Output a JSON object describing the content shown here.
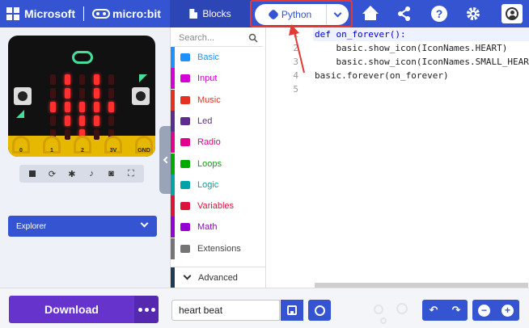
{
  "header": {
    "microsoft": "Microsoft",
    "microbit": "micro:bit",
    "blocks_label": "Blocks",
    "python_label": "Python"
  },
  "simulator": {
    "pin_labels": [
      "0",
      "1",
      "2",
      "3V",
      "GND"
    ],
    "button_a": "A",
    "button_b": "B",
    "leds_on": [
      [
        1,
        1
      ],
      [
        1,
        3
      ],
      [
        2,
        0
      ],
      [
        2,
        1
      ],
      [
        2,
        2
      ],
      [
        2,
        3
      ],
      [
        2,
        4
      ],
      [
        3,
        1
      ],
      [
        3,
        2
      ],
      [
        3,
        3
      ],
      [
        4,
        2
      ],
      [
        0,
        1
      ],
      [
        0,
        3
      ]
    ],
    "explorer_label": "Explorer"
  },
  "toolbox": {
    "search_placeholder": "Search...",
    "categories": [
      {
        "label": "Basic",
        "color": "#1e90ff"
      },
      {
        "label": "Input",
        "color": "#d400d4"
      },
      {
        "label": "Music",
        "color": "#e63022"
      },
      {
        "label": "Led",
        "color": "#5c2d91"
      },
      {
        "label": "Radio",
        "color": "#e3008c"
      },
      {
        "label": "Loops",
        "color": "#00aa00"
      },
      {
        "label": "Logic",
        "color": "#00a4a6"
      },
      {
        "label": "Variables",
        "color": "#dc143c"
      },
      {
        "label": "Math",
        "color": "#9400d3"
      },
      {
        "label": "Extensions",
        "color": "#757575"
      }
    ],
    "advanced_label": "Advanced"
  },
  "editor": {
    "line_numbers": [
      "1",
      "2",
      "3",
      "4",
      "5"
    ],
    "lines": [
      "def on_forever():",
      "    basic.show_icon(IconNames.HEART)",
      "    basic.show_icon(IconNames.SMALL_HEART)",
      "basic.forever(on_forever)",
      ""
    ]
  },
  "bottom": {
    "download_label": "Download",
    "project_name": "heart beat"
  },
  "colors": {
    "accent": "#3454d1",
    "download": "#6633cc",
    "highlight": "#e53935"
  }
}
